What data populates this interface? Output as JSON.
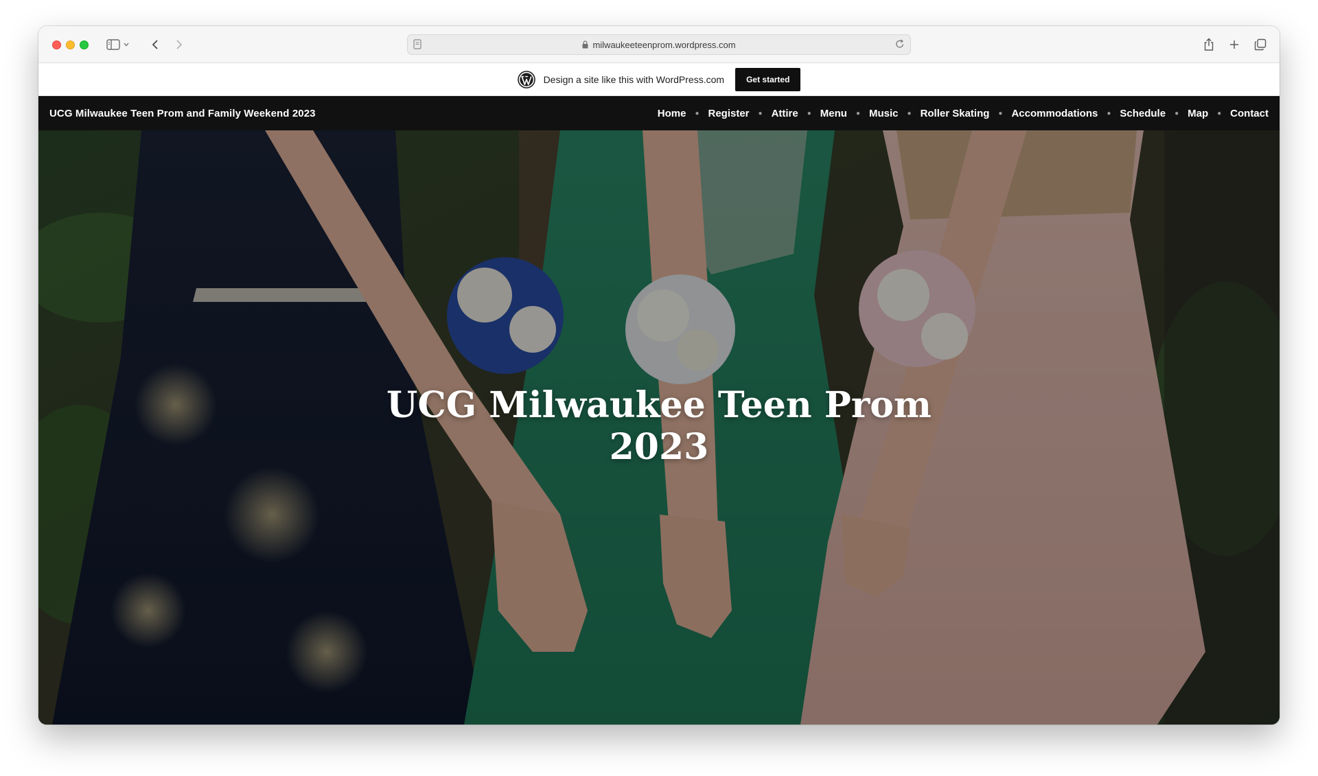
{
  "browser": {
    "url": "milwaukeeteenprom.wordpress.com"
  },
  "promo": {
    "text": "Design a site like this with WordPress.com",
    "button_label": "Get started"
  },
  "site": {
    "title": "UCG Milwaukee Teen Prom and Family Weekend 2023",
    "nav": [
      {
        "label": "Home"
      },
      {
        "label": "Register"
      },
      {
        "label": "Attire"
      },
      {
        "label": "Menu"
      },
      {
        "label": "Music"
      },
      {
        "label": "Roller Skating"
      },
      {
        "label": "Accommodations"
      },
      {
        "label": "Schedule"
      },
      {
        "label": "Map"
      },
      {
        "label": "Contact"
      }
    ]
  },
  "hero": {
    "title_line1": "UCG Milwaukee Teen Prom",
    "title_line2": "2023"
  },
  "colors": {
    "header_bg": "#111111",
    "button_bg": "#101010",
    "close_dot": "#ff5f57",
    "minimize_dot": "#febc2e",
    "zoom_dot": "#28c840"
  }
}
